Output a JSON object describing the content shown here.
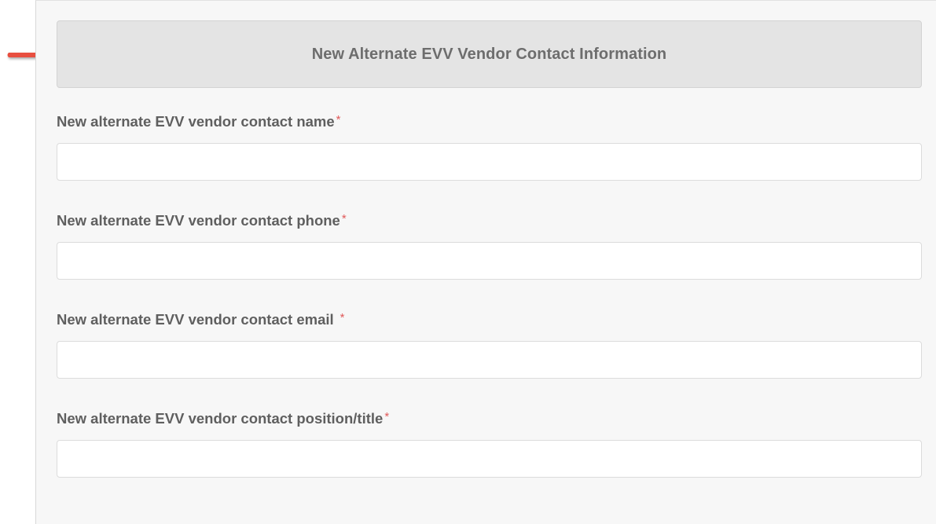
{
  "section": {
    "title": "New Alternate EVV Vendor Contact Information"
  },
  "fields": [
    {
      "label": "New alternate EVV vendor contact name",
      "required_mark": "*",
      "value": "",
      "placeholder": ""
    },
    {
      "label": "New alternate EVV vendor contact phone",
      "required_mark": "*",
      "value": "",
      "placeholder": ""
    },
    {
      "label": "New alternate EVV vendor contact email",
      "required_mark": "*",
      "value": "",
      "placeholder": ""
    },
    {
      "label": "New alternate EVV vendor contact position/title",
      "required_mark": "*",
      "value": "",
      "placeholder": ""
    }
  ],
  "annotation": {
    "icon": "arrow-right-icon",
    "color": "#e8503f"
  },
  "colors": {
    "header_bg": "#e4e4e4",
    "panel_bg": "#f7f7f7",
    "required": "#e05a5a"
  }
}
